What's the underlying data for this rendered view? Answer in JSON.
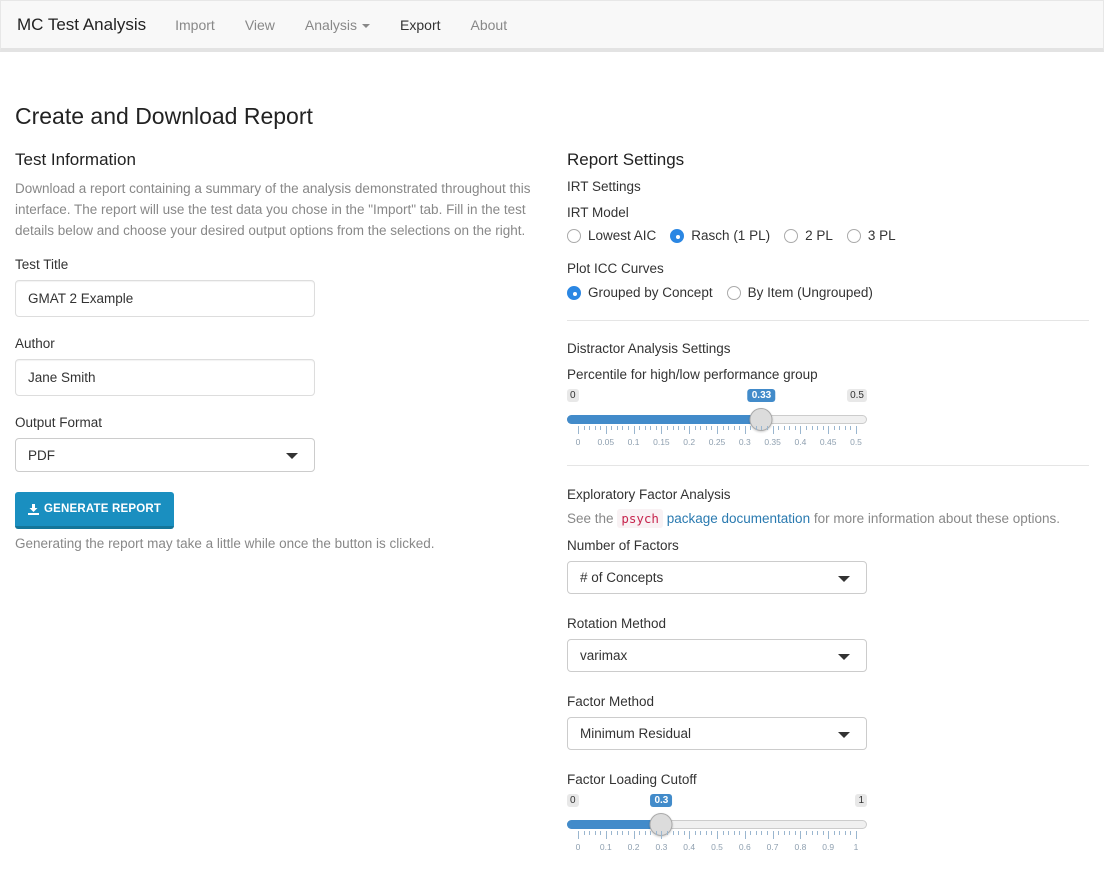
{
  "navbar": {
    "brand": "MC Test Analysis",
    "items": [
      {
        "label": "Import",
        "active": false
      },
      {
        "label": "View",
        "active": false
      },
      {
        "label": "Analysis",
        "active": false,
        "dropdown": true
      },
      {
        "label": "Export",
        "active": true
      },
      {
        "label": "About",
        "active": false
      }
    ]
  },
  "page_title": "Create and Download Report",
  "test_info": {
    "heading": "Test Information",
    "description": "Download a report containing a summary of the analysis demonstrated throughout this interface. The report will use the test data you chose in the \"Import\" tab. Fill in the test details below and choose your desired output options from the selections on the right.",
    "test_title_label": "Test Title",
    "test_title_value": "GMAT 2 Example",
    "author_label": "Author",
    "author_value": "Jane Smith",
    "output_format_label": "Output Format",
    "output_format_value": "PDF",
    "generate_button": "GENERATE REPORT",
    "generate_icon": "download-icon",
    "generate_note": "Generating the report may take a little while once the button is clicked."
  },
  "report_settings": {
    "heading": "Report Settings",
    "irt_heading": "IRT Settings",
    "irt_model_label": "IRT Model",
    "irt_model_options": [
      {
        "label": "Lowest AIC",
        "selected": false
      },
      {
        "label": "Rasch (1 PL)",
        "selected": true
      },
      {
        "label": "2 PL",
        "selected": false
      },
      {
        "label": "3 PL",
        "selected": false
      }
    ],
    "icc_label": "Plot ICC Curves",
    "icc_options": [
      {
        "label": "Grouped by Concept",
        "selected": true
      },
      {
        "label": "By Item (Ungrouped)",
        "selected": false
      }
    ],
    "distractor_heading": "Distractor Analysis Settings",
    "percentile_label": "Percentile for high/low performance group",
    "percentile_slider": {
      "min": 0,
      "max": 0.5,
      "value": 0.33,
      "min_label": "0",
      "max_label": "0.5",
      "value_label": "0.33",
      "ticks": [
        "0",
        "0.05",
        "0.1",
        "0.15",
        "0.2",
        "0.25",
        "0.3",
        "0.35",
        "0.4",
        "0.45",
        "0.5"
      ]
    },
    "efa_heading": "Exploratory Factor Analysis",
    "efa_note_prefix": "See the",
    "efa_note_code": "psych",
    "efa_note_link": "package documentation",
    "efa_note_suffix": "for more information about these options.",
    "num_factors_label": "Number of Factors",
    "num_factors_value": "# of Concepts",
    "rotation_label": "Rotation Method",
    "rotation_value": "varimax",
    "factor_method_label": "Factor Method",
    "factor_method_value": "Minimum Residual",
    "cutoff_label": "Factor Loading Cutoff",
    "cutoff_slider": {
      "min": 0,
      "max": 1,
      "value": 0.3,
      "min_label": "0",
      "max_label": "1",
      "value_label": "0.3",
      "ticks": [
        "0",
        "0.1",
        "0.2",
        "0.3",
        "0.4",
        "0.5",
        "0.6",
        "0.7",
        "0.8",
        "0.9",
        "1"
      ]
    }
  },
  "colors": {
    "accent": "#428bca",
    "button": "#1a8fc0",
    "radio_selected": "#2b87e3",
    "code_text": "#c7254e",
    "link": "#2a7ab0"
  }
}
